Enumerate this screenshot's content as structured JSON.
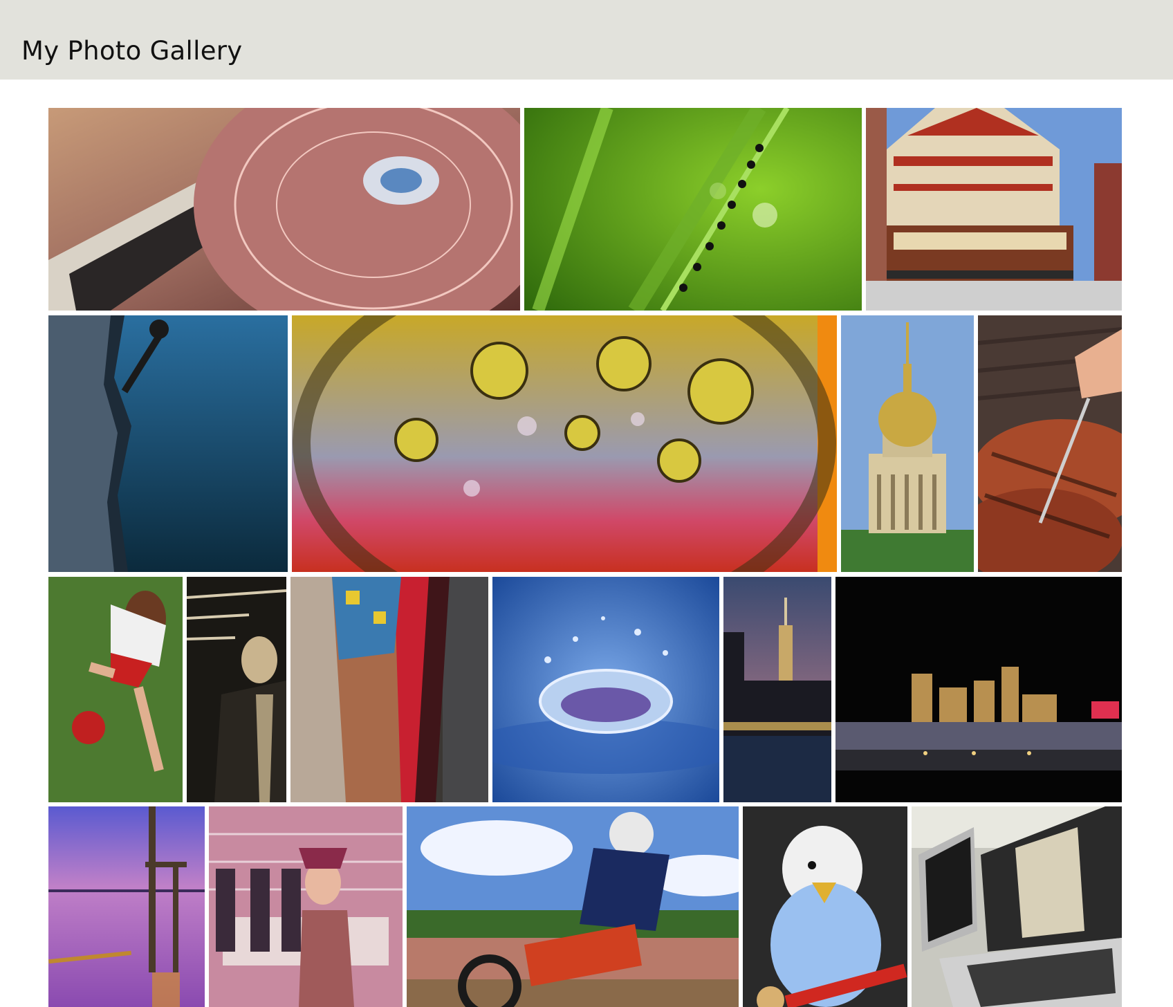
{
  "header": {
    "title": "My Photo Gallery",
    "background": "#e2e2dc"
  },
  "photos": [
    {
      "subject": "dj-turntable",
      "bg": "#8a5a50"
    },
    {
      "subject": "ants-on-grass",
      "bg": "#4f8f1a"
    },
    {
      "subject": "chinatown-cable-car",
      "bg": "#6f9ad8"
    },
    {
      "subject": "rock-climber",
      "bg": "#1f5578"
    },
    {
      "subject": "oil-water-macro",
      "bg": "#b59a2a"
    },
    {
      "subject": "domed-cathedral",
      "bg": "#7fa6d8"
    },
    {
      "subject": "grilled-steak",
      "bg": "#8b3a22"
    },
    {
      "subject": "girl-kicking-ball",
      "bg": "#4d7a30"
    },
    {
      "subject": "man-in-leather-jacket",
      "bg": "#2c2a24"
    },
    {
      "subject": "colorful-sweater",
      "bg": "#8a4a3a"
    },
    {
      "subject": "water-drop-splash",
      "bg": "#3b6fb8"
    },
    {
      "subject": "empire-state-skyline",
      "bg": "#3a4a66"
    },
    {
      "subject": "las-vegas-night",
      "bg": "#050505"
    },
    {
      "subject": "pier-at-dusk",
      "bg": "#8b5bb0"
    },
    {
      "subject": "costumed-woman-on-bench",
      "bg": "#a0607a"
    },
    {
      "subject": "motocross-rider",
      "bg": "#5f8fd6"
    },
    {
      "subject": "budgie-parrot",
      "bg": "#2a2a2a"
    },
    {
      "subject": "laptops-on-desk",
      "bg": "#9a9a96"
    }
  ]
}
